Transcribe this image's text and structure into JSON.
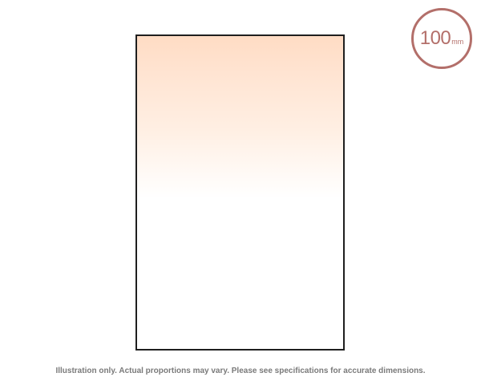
{
  "badge": {
    "number": "100",
    "unit": "mm",
    "color": "#b36f6a"
  },
  "filter": {
    "gradient_top_color": "#ffdcc4",
    "gradient_bottom_color": "#ffffff",
    "border_color": "#1f1f1f"
  },
  "disclaimer": {
    "text": "Illustration only. Actual proportions may vary. Please see specifications for accurate dimensions."
  }
}
